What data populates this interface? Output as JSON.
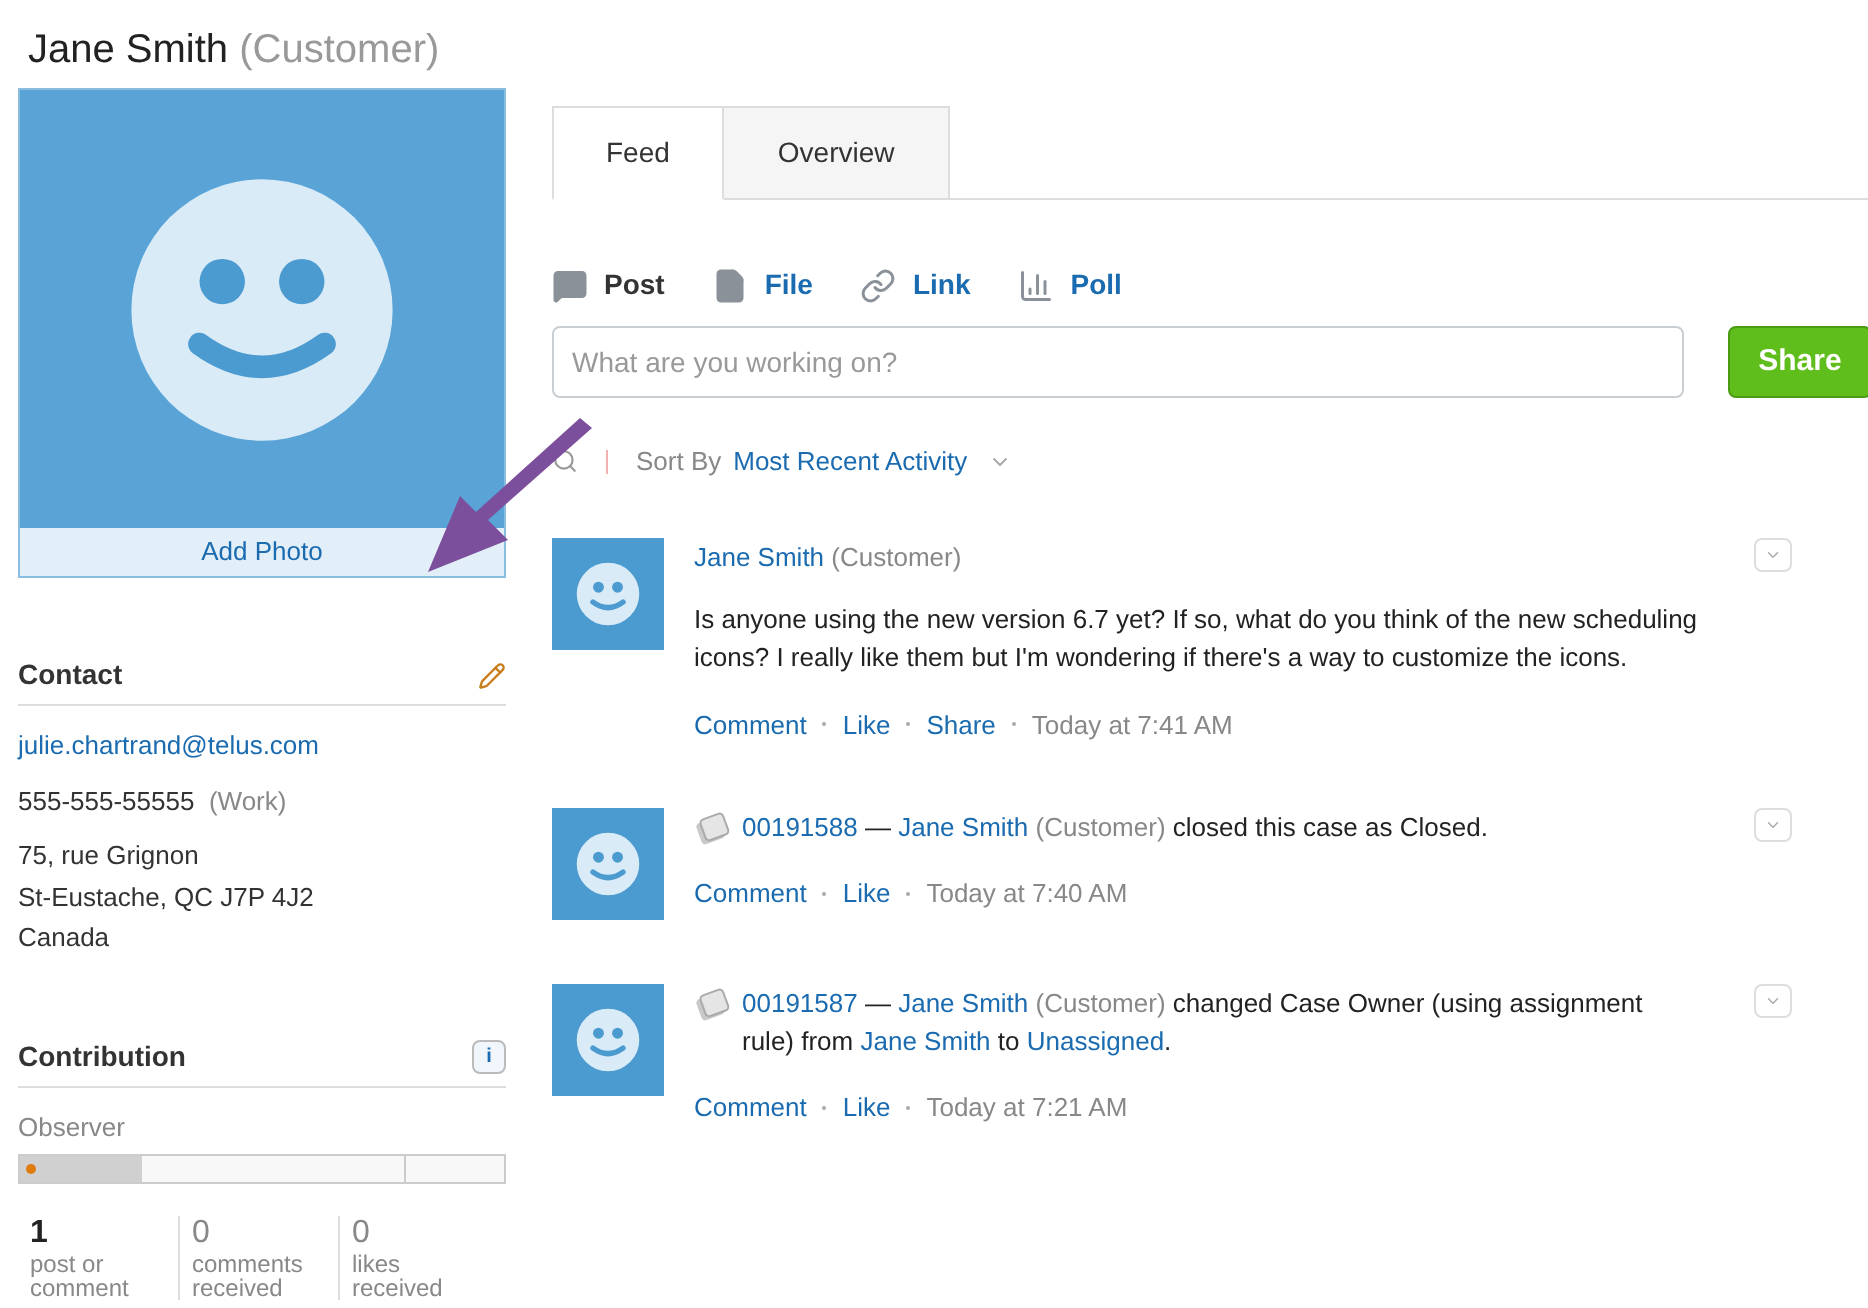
{
  "header": {
    "name": "Jane Smith",
    "role": "(Customer)"
  },
  "photo": {
    "action": "Add Photo"
  },
  "contact": {
    "title": "Contact",
    "email": "julie.chartrand@telus.com",
    "phone": "555-555-55555",
    "phone_type": "(Work)",
    "address": [
      "75, rue Grignon",
      "St-Eustache, QC J7P 4J2",
      "Canada"
    ]
  },
  "contribution": {
    "title": "Contribution",
    "info": "i",
    "level_name": "Observer",
    "level": 0.25,
    "stats": [
      {
        "count": "1",
        "label": "post or comment",
        "bold": true
      },
      {
        "count": "0",
        "label": "comments received",
        "bold": false
      },
      {
        "count": "0",
        "label": "likes received",
        "bold": false
      }
    ]
  },
  "tabs": [
    {
      "label": "Feed",
      "selected": true
    },
    {
      "label": "Overview",
      "selected": false
    }
  ],
  "composer": {
    "options": [
      {
        "label": "Post",
        "kind": "post",
        "selected": true
      },
      {
        "label": "File",
        "kind": "file",
        "selected": false
      },
      {
        "label": "Link",
        "kind": "link",
        "selected": false
      },
      {
        "label": "Poll",
        "kind": "poll",
        "selected": false
      }
    ],
    "placeholder": "What are you working on?",
    "button": "Share"
  },
  "sort": {
    "label": "Sort By",
    "value": "Most Recent Activity"
  },
  "feed": [
    {
      "kind": "post",
      "header": [
        {
          "kind": "link",
          "text": "Jane Smith"
        },
        {
          "kind": "muted",
          "text": "(Customer)"
        }
      ],
      "body": "Is anyone using the new version 6.7 yet? If so, what do you think of the new scheduling icons? I really like them but I'm wondering if there's a way to customize the icons.",
      "actions": [
        "Comment",
        "Like",
        "Share"
      ],
      "time": "Today at 7:41 AM"
    },
    {
      "kind": "case",
      "header": [
        {
          "kind": "link",
          "text": "00191588"
        },
        {
          "kind": "text",
          "text": "—"
        },
        {
          "kind": "link",
          "text": "Jane Smith"
        },
        {
          "kind": "muted",
          "text": "(Customer)"
        },
        {
          "kind": "text",
          "text": "closed this case as Closed."
        }
      ],
      "actions": [
        "Comment",
        "Like"
      ],
      "time": "Today at 7:40 AM"
    },
    {
      "kind": "case",
      "header": [
        {
          "kind": "link",
          "text": "00191587"
        },
        {
          "kind": "text",
          "text": "—"
        },
        {
          "kind": "link",
          "text": "Jane Smith"
        },
        {
          "kind": "muted",
          "text": "(Customer)"
        },
        {
          "kind": "text",
          "text": "changed Case Owner (using assignment rule) from"
        },
        {
          "kind": "link",
          "text": "Jane Smith"
        },
        {
          "kind": "text",
          "text": "to"
        },
        {
          "kind": "link",
          "text": "Unassigned"
        },
        {
          "kind": "text",
          "text": "."
        }
      ],
      "actions": [
        "Comment",
        "Like"
      ],
      "time": "Today at 7:21 AM"
    }
  ]
}
